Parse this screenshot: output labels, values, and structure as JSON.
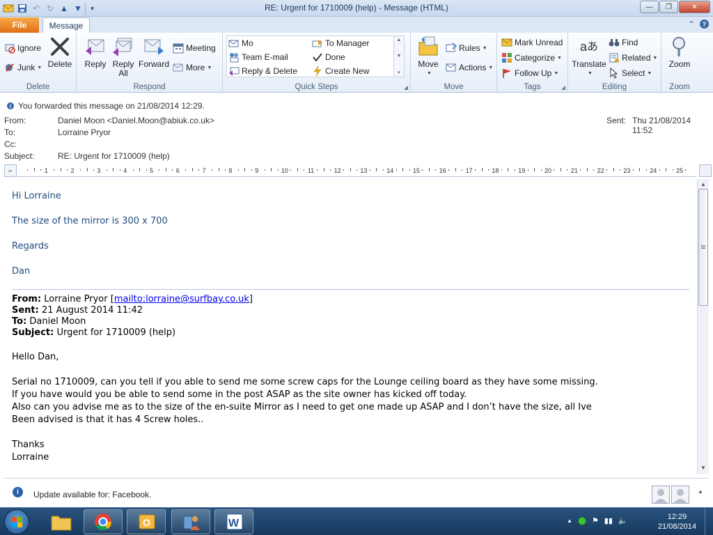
{
  "window": {
    "title": "RE: Urgent for 1710009 (help)  -  Message (HTML)",
    "minimize": "—",
    "restore": "❐",
    "close": "✕"
  },
  "tabs": {
    "file": "File",
    "message": "Message"
  },
  "ribbon": {
    "delete_group": {
      "label": "Delete",
      "ignore": "Ignore",
      "junk": "Junk",
      "delete": "Delete"
    },
    "respond_group": {
      "label": "Respond",
      "reply": "Reply",
      "reply_all_1": "Reply",
      "reply_all_2": "All",
      "forward": "Forward",
      "meeting": "Meeting",
      "more": "More"
    },
    "quick_steps": {
      "label": "Quick Steps",
      "items": [
        "Mo",
        "To Manager",
        "Team E-mail",
        "Done",
        "Reply & Delete",
        "Create New"
      ]
    },
    "move_group": {
      "label": "Move",
      "move": "Move",
      "rules": "Rules",
      "actions": "Actions"
    },
    "tags_group": {
      "label": "Tags",
      "mark_unread": "Mark Unread",
      "categorize": "Categorize",
      "follow_up": "Follow Up"
    },
    "editing_group": {
      "label": "Editing",
      "translate": "Translate",
      "find": "Find",
      "related": "Related",
      "select": "Select"
    },
    "zoom_group": {
      "label": "Zoom",
      "zoom": "Zoom"
    }
  },
  "header": {
    "info": "You forwarded this message on 21/08/2014 12:29.",
    "from_label": "From:",
    "from": "Daniel Moon <Daniel.Moon@abiuk.co.uk>",
    "to_label": "To:",
    "to": "Lorraine Pryor",
    "cc_label": "Cc:",
    "subject_label": "Subject:",
    "subject": "RE: Urgent for 1710009 (help)",
    "sent_label": "Sent:",
    "sent": "Thu 21/08/2014 11:52"
  },
  "ruler": {
    "numbers": [
      "1",
      "2",
      "3",
      "4",
      "5",
      "6",
      "7",
      "8",
      "9",
      "10",
      "11",
      "12",
      "13",
      "14",
      "15",
      "16",
      "17",
      "18",
      "19",
      "20",
      "21",
      "22",
      "23",
      "24",
      "25"
    ]
  },
  "body": {
    "greeting": "Hi Lorraine",
    "line1": "The size of the mirror is 300 x 700",
    "regards": "Regards",
    "signature": "Dan",
    "quoted": {
      "from_label": "From:",
      "from_name": "Lorraine Pryor",
      "from_link": "mailto:lorraine@surfbay.co.uk",
      "sent_label": "Sent:",
      "sent": "21 August 2014 11:42",
      "to_label": "To:",
      "to": "Daniel Moon",
      "subject_label": "Subject:",
      "subject": "Urgent for 1710009 (help)",
      "greeting": "Hello Dan,",
      "line1": "Serial no 1710009, can you tell if you able to send me some screw caps for the Lounge ceiling board as they have some missing.",
      "line2": "If you have would you be able to send some in the post ASAP as the site owner has kicked off today.",
      "line3": "Also can you advise me as to the size of the en-suite Mirror as I need to get one made up ASAP and I don’t have the size, all Ive",
      "line4": "Been advised is that it has 4 Screw holes..",
      "thanks": "Thanks",
      "name": "Lorraine"
    }
  },
  "update_bar": {
    "text": "Update available for: Facebook."
  },
  "taskbar": {
    "time": "12:29",
    "date": "21/08/2014"
  }
}
